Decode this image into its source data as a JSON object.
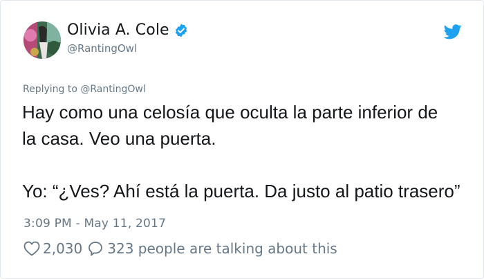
{
  "tweet": {
    "author": {
      "display_name": "Olivia A. Cole",
      "handle": "@RantingOwl",
      "verified": true
    },
    "reply_to": "Replying to @RantingOwl",
    "text_line1": "Hay como una celosía que oculta la parte inferior de",
    "text_line2": "la casa. Veo una puerta.",
    "text_line3": "",
    "text_line4": "Yo: “¿Ves? Ahí está la puerta. Da justo al patio trasero”",
    "timestamp": "3:09 PM - May 11, 2017",
    "likes": "2,030",
    "conversation": "323 people are talking about this",
    "icons": {
      "verified": "verified-badge-icon",
      "brand": "twitter-bird-icon",
      "like": "heart-icon",
      "reply": "speech-bubble-icon"
    },
    "colors": {
      "brand_blue": "#1da1f2",
      "text": "#14171a",
      "muted": "#657786",
      "border": "#e1e8ed"
    }
  }
}
